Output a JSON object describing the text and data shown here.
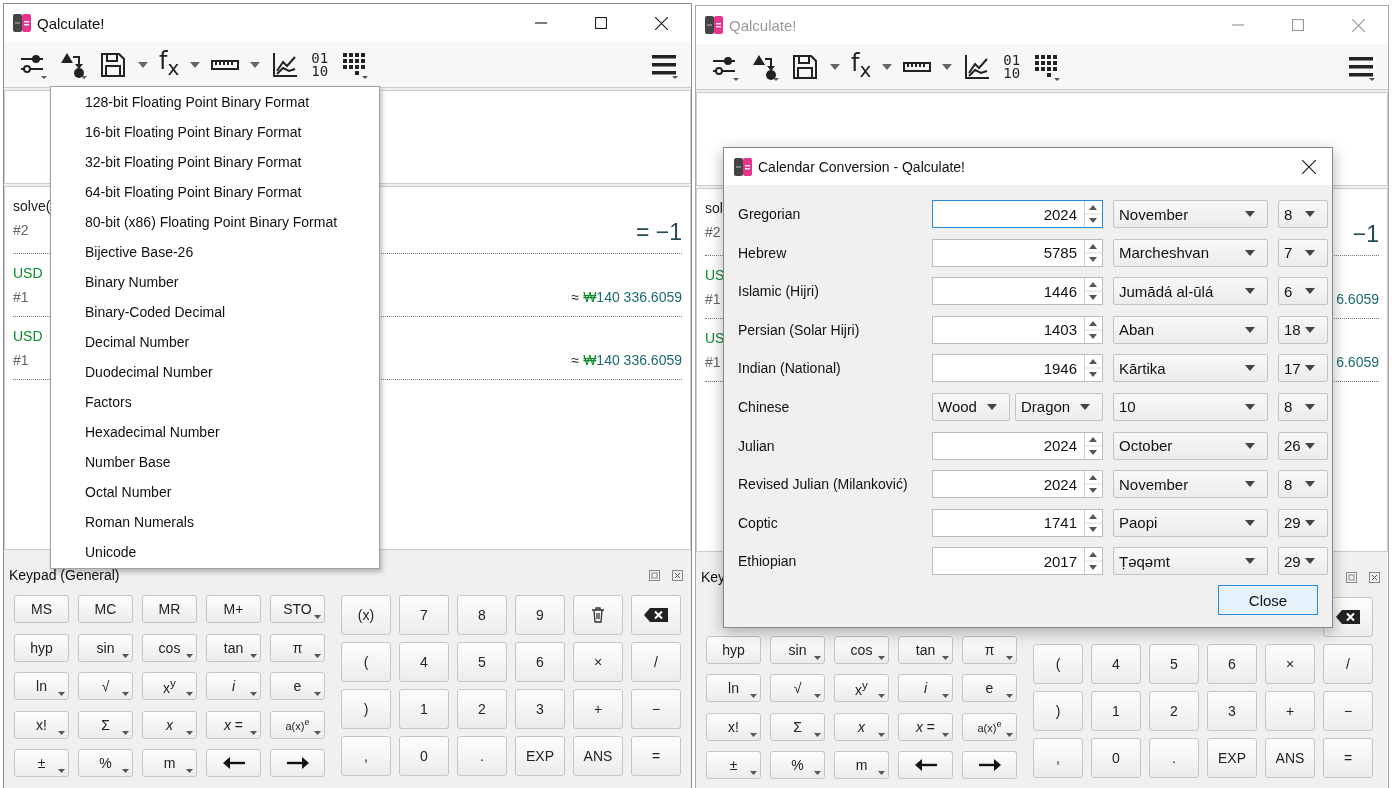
{
  "windows": [
    {
      "title": "Qalculate!",
      "active": true,
      "toolbar": [
        {
          "kind": "mode",
          "corner": true,
          "split": false
        },
        {
          "kind": "convert",
          "corner": true,
          "split": false
        },
        {
          "kind": "save",
          "corner": false,
          "split": true
        },
        {
          "kind": "functions",
          "label": "f$_{x}$",
          "corner": false,
          "split": true
        },
        {
          "kind": "units",
          "corner": false,
          "split": true
        },
        {
          "kind": "plot",
          "corner": false,
          "split": false
        },
        {
          "kind": "base",
          "lines": [
            "01",
            "10"
          ],
          "corner": false,
          "split": false
        },
        {
          "kind": "keypad",
          "corner": true,
          "split": false
        },
        {
          "kind": "menu",
          "corner": true,
          "split": false
        }
      ],
      "history": [
        {
          "expr": [
            {
              "text": "solve(",
              "kind": "plain"
            }
          ],
          "index": "#2",
          "result": [
            {
              "text": "= −1",
              "kind": "number"
            }
          ],
          "large": true
        },
        {
          "expr": [
            {
              "text": "USD",
              "kind": "unit"
            }
          ],
          "index": "#1",
          "result": [
            {
              "text": "≈ ",
              "kind": "plain"
            },
            {
              "text": "₩",
              "kind": "unit"
            },
            {
              "text": "140 336.6059",
              "kind": "number"
            }
          ],
          "large": false
        },
        {
          "expr": [
            {
              "text": "USD",
              "kind": "unit"
            }
          ],
          "index": "#1",
          "result": [
            {
              "text": "≈ ",
              "kind": "plain"
            },
            {
              "text": "₩",
              "kind": "unit"
            },
            {
              "text": "140 336.6059",
              "kind": "number"
            }
          ],
          "large": false
        }
      ],
      "keypad": {
        "title": "Keypad (General)",
        "left": [
          [
            {
              "label": "MS",
              "kind": "text",
              "menu": false
            },
            {
              "label": "MC",
              "kind": "text",
              "menu": false
            },
            {
              "label": "MR",
              "kind": "text",
              "menu": false
            },
            {
              "label": "M+",
              "kind": "text",
              "menu": false
            },
            {
              "label": "STO",
              "kind": "text",
              "menu": true
            }
          ],
          [
            {
              "label": "hyp",
              "kind": "text",
              "menu": false
            },
            {
              "label": "sin",
              "kind": "text",
              "menu": true
            },
            {
              "label": "cos",
              "kind": "text",
              "menu": true
            },
            {
              "label": "tan",
              "kind": "text",
              "menu": true
            },
            {
              "label": "π",
              "kind": "text",
              "menu": true
            }
          ],
          [
            {
              "label": "ln",
              "kind": "text",
              "menu": true
            },
            {
              "label": "√",
              "kind": "text",
              "menu": true
            },
            {
              "label": "x$^{y}$",
              "kind": "text",
              "menu": true
            },
            {
              "label": "i",
              "kind": "italic",
              "menu": true
            },
            {
              "label": "e",
              "kind": "text",
              "menu": true
            }
          ],
          [
            {
              "label": "x!",
              "kind": "text",
              "menu": true
            },
            {
              "label": "Σ",
              "kind": "text",
              "menu": true
            },
            {
              "label": "x",
              "kind": "italic",
              "menu": true
            },
            {
              "label": "*x* =",
              "kind": "text",
              "menu": true
            },
            {
              "label": "a(x)$^{e}$",
              "kind": "small",
              "menu": true
            }
          ],
          [
            {
              "label": "±",
              "kind": "text",
              "menu": true
            },
            {
              "label": "%",
              "kind": "text",
              "menu": true
            },
            {
              "label": "m",
              "kind": "text",
              "menu": true
            },
            {
              "kind": "left",
              "menu": false
            },
            {
              "kind": "right",
              "menu": false
            }
          ]
        ],
        "right": [
          [
            {
              "label": "(x)",
              "kind": "text",
              "menu": false
            },
            {
              "label": "7",
              "kind": "text",
              "menu": false
            },
            {
              "label": "8",
              "kind": "text",
              "menu": false
            },
            {
              "label": "9",
              "kind": "text",
              "menu": false
            },
            {
              "kind": "delete",
              "menu": false
            },
            {
              "kind": "backspace",
              "menu": false
            }
          ],
          [
            {
              "label": "(",
              "kind": "text",
              "menu": false
            },
            {
              "label": "4",
              "kind": "text",
              "menu": false
            },
            {
              "label": "5",
              "kind": "text",
              "menu": false
            },
            {
              "label": "6",
              "kind": "text",
              "menu": false
            },
            {
              "label": "×",
              "kind": "text",
              "menu": false
            },
            {
              "label": "/",
              "kind": "text",
              "menu": false
            }
          ],
          [
            {
              "label": ")",
              "kind": "text",
              "menu": false
            },
            {
              "label": "1",
              "kind": "text",
              "menu": false
            },
            {
              "label": "2",
              "kind": "text",
              "menu": false
            },
            {
              "label": "3",
              "kind": "text",
              "menu": false
            },
            {
              "label": "+",
              "kind": "text",
              "menu": false
            },
            {
              "label": "−",
              "kind": "text",
              "menu": false
            }
          ],
          [
            {
              "label": ",",
              "kind": "text",
              "menu": false
            },
            {
              "label": "0",
              "kind": "text",
              "menu": false
            },
            {
              "label": ".",
              "kind": "text",
              "menu": false
            },
            {
              "label": "EXP",
              "kind": "text",
              "menu": false
            },
            {
              "label": "ANS",
              "kind": "text",
              "menu": false
            },
            {
              "label": "=",
              "kind": "text",
              "menu": false
            }
          ]
        ]
      }
    },
    {
      "title": "Qalculate!",
      "active": false,
      "toolbar": [
        {
          "kind": "mode",
          "corner": true,
          "split": false
        },
        {
          "kind": "convert",
          "corner": true,
          "split": false
        },
        {
          "kind": "save",
          "corner": false,
          "split": true
        },
        {
          "kind": "functions",
          "label": "f$_{x}$",
          "corner": false,
          "split": true
        },
        {
          "kind": "units",
          "corner": false,
          "split": true
        },
        {
          "kind": "plot",
          "corner": false,
          "split": false
        },
        {
          "kind": "base",
          "lines": [
            "01",
            "10"
          ],
          "corner": false,
          "split": false
        },
        {
          "kind": "keypad",
          "corner": true,
          "split": false
        },
        {
          "kind": "menu",
          "corner": true,
          "split": false
        }
      ],
      "history": [
        {
          "expr": [
            {
              "text": "sol",
              "kind": "plain"
            }
          ],
          "index": "#2",
          "result": [
            {
              "text": "−1",
              "kind": "number"
            }
          ],
          "large": true
        },
        {
          "expr": [
            {
              "text": "US",
              "kind": "unit"
            }
          ],
          "index": "#1",
          "result": [
            {
              "text": "6.6059",
              "kind": "number"
            }
          ],
          "large": false
        },
        {
          "expr": [
            {
              "text": "US",
              "kind": "unit"
            }
          ],
          "index": "#1",
          "result": [
            {
              "text": "6.6059",
              "kind": "number"
            }
          ],
          "large": false
        }
      ],
      "keypad": {
        "title": "Key",
        "left": [
          [
            {
              "label": "hyp",
              "kind": "text",
              "menu": false
            },
            {
              "label": "sin",
              "kind": "text",
              "menu": true
            },
            {
              "label": "cos",
              "kind": "text",
              "menu": true
            },
            {
              "label": "tan",
              "kind": "text",
              "menu": true
            },
            {
              "label": "π",
              "kind": "text",
              "menu": true
            }
          ],
          [
            {
              "label": "ln",
              "kind": "text",
              "menu": true
            },
            {
              "label": "√",
              "kind": "text",
              "menu": true
            },
            {
              "label": "x$^{y}$",
              "kind": "text",
              "menu": true
            },
            {
              "label": "i",
              "kind": "italic",
              "menu": true
            },
            {
              "label": "e",
              "kind": "text",
              "menu": true
            }
          ],
          [
            {
              "label": "x!",
              "kind": "text",
              "menu": true
            },
            {
              "label": "Σ",
              "kind": "text",
              "menu": true
            },
            {
              "label": "x",
              "kind": "italic",
              "menu": true
            },
            {
              "label": "*x* =",
              "kind": "text",
              "menu": true
            },
            {
              "label": "a(x)$^{e}$",
              "kind": "small",
              "menu": true
            }
          ],
          [
            {
              "label": "±",
              "kind": "text",
              "menu": true
            },
            {
              "label": "%",
              "kind": "text",
              "menu": true
            },
            {
              "label": "m",
              "kind": "text",
              "menu": true
            },
            {
              "kind": "left",
              "menu": false
            },
            {
              "kind": "right",
              "menu": false
            }
          ]
        ],
        "right": [
          [
            {
              "kind": "backspace",
              "menu": false
            }
          ],
          [
            {
              "label": "(",
              "kind": "text",
              "menu": false
            },
            {
              "label": "4",
              "kind": "text",
              "menu": false
            },
            {
              "label": "5",
              "kind": "text",
              "menu": false
            },
            {
              "label": "6",
              "kind": "text",
              "menu": false
            },
            {
              "label": "×",
              "kind": "text",
              "menu": false
            },
            {
              "label": "/",
              "kind": "text",
              "menu": false
            }
          ],
          [
            {
              "label": ")",
              "kind": "text",
              "menu": false
            },
            {
              "label": "1",
              "kind": "text",
              "menu": false
            },
            {
              "label": "2",
              "kind": "text",
              "menu": false
            },
            {
              "label": "3",
              "kind": "text",
              "menu": false
            },
            {
              "label": "+",
              "kind": "text",
              "menu": false
            },
            {
              "label": "−",
              "kind": "text",
              "menu": false
            }
          ],
          [
            {
              "label": ",",
              "kind": "text",
              "menu": false
            },
            {
              "label": "0",
              "kind": "text",
              "menu": false
            },
            {
              "label": ".",
              "kind": "text",
              "menu": false
            },
            {
              "label": "EXP",
              "kind": "text",
              "menu": false
            },
            {
              "label": "ANS",
              "kind": "text",
              "menu": false
            },
            {
              "label": "=",
              "kind": "text",
              "menu": false
            }
          ]
        ]
      }
    }
  ],
  "menu": {
    "items": [
      "128-bit Floating Point Binary Format",
      "16-bit Floating Point Binary Format",
      "32-bit Floating Point Binary Format",
      "64-bit Floating Point Binary Format",
      "80-bit (x86) Floating Point Binary Format",
      "Bijective Base-26",
      "Binary Number",
      "Binary-Coded Decimal",
      "Decimal Number",
      "Duodecimal Number",
      "Factors",
      "Hexadecimal Number",
      "Number Base",
      "Octal Number",
      "Roman Numerals",
      "Unicode"
    ]
  },
  "dialog": {
    "title": "Calendar Conversion - Qalculate!",
    "close": "Close",
    "rows": [
      {
        "label": "Gregorian",
        "kind": "year",
        "year": "2024",
        "focused": true,
        "month": "November",
        "day": "8"
      },
      {
        "label": "Hebrew",
        "kind": "year",
        "year": "5785",
        "focused": false,
        "month": "Marcheshvan",
        "day": "7"
      },
      {
        "label": "Islamic (Hijri)",
        "kind": "year",
        "year": "1446",
        "focused": false,
        "month": "Jumādá al-ūlá",
        "day": "6"
      },
      {
        "label": "Persian (Solar Hijri)",
        "kind": "year",
        "year": "1403",
        "focused": false,
        "month": "Aban",
        "day": "18"
      },
      {
        "label": "Indian (National)",
        "kind": "year",
        "year": "1946",
        "focused": false,
        "month": "Kārtika",
        "day": "17"
      },
      {
        "label": "Chinese",
        "kind": "cycle",
        "stem": "Wood",
        "branch": "Dragon",
        "month": "10",
        "day": "8"
      },
      {
        "label": "Julian",
        "kind": "year",
        "year": "2024",
        "focused": false,
        "month": "October",
        "day": "26"
      },
      {
        "label": "Revised Julian (Milanković)",
        "kind": "year",
        "year": "2024",
        "focused": false,
        "month": "November",
        "day": "8"
      },
      {
        "label": "Coptic",
        "kind": "year",
        "year": "1741",
        "focused": false,
        "month": "Paopi",
        "day": "29"
      },
      {
        "label": "Ethiopian",
        "kind": "year",
        "year": "2017",
        "focused": false,
        "month": "Ṭəqəmt",
        "day": "29"
      }
    ]
  }
}
